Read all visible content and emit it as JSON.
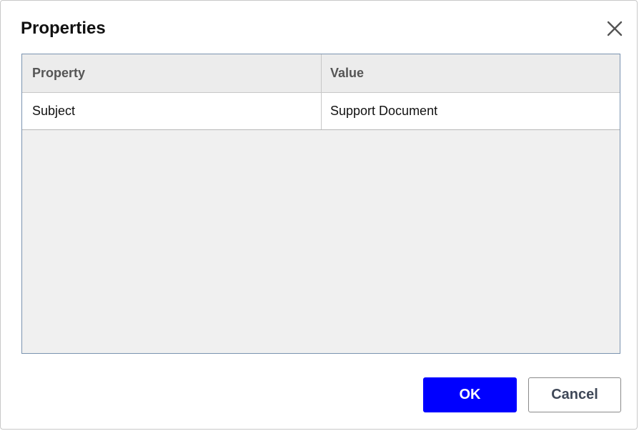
{
  "dialog": {
    "title": "Properties"
  },
  "grid": {
    "columns": [
      {
        "label": "Property"
      },
      {
        "label": "Value"
      }
    ],
    "rows": [
      {
        "property": "Subject",
        "value": "Support Document"
      }
    ]
  },
  "buttons": {
    "ok_label": "OK",
    "cancel_label": "Cancel"
  },
  "icons": {
    "close": "close-icon"
  },
  "colors": {
    "ok_button": "#0000ff",
    "grid_border": "#7a93b0",
    "grid_background": "#f0f0f0"
  }
}
